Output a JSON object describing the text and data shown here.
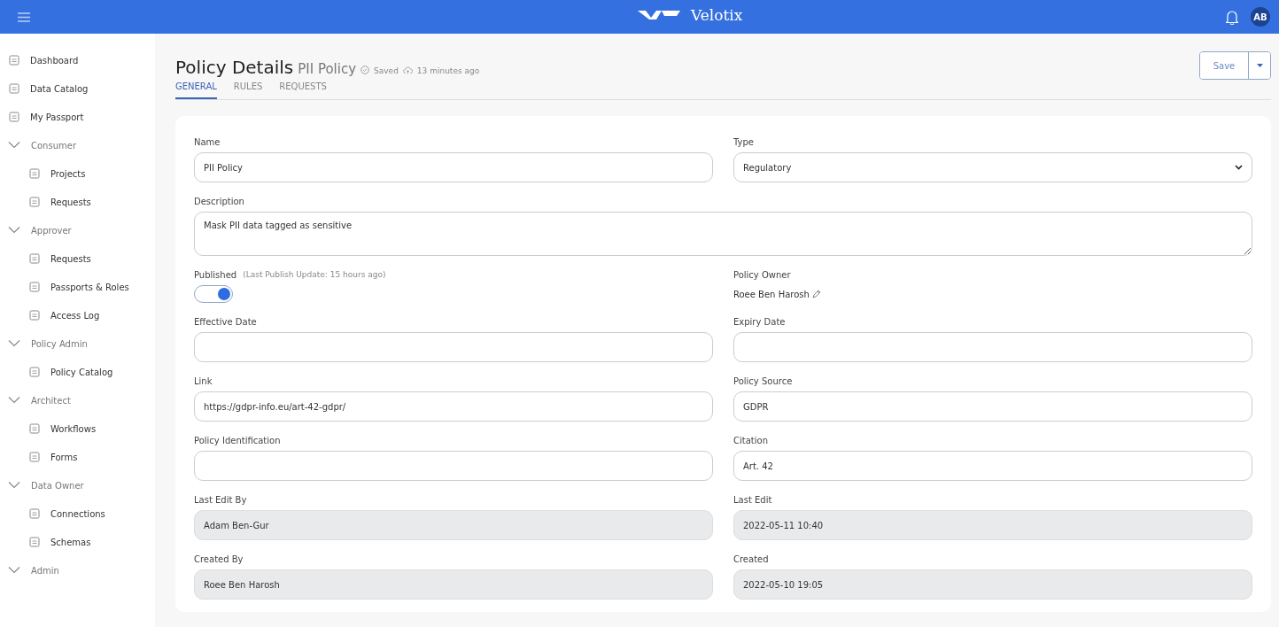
{
  "header": {
    "brand": "Velotix",
    "avatar": "AB"
  },
  "sidebar": {
    "items": [
      {
        "kind": "link",
        "label": "Dashboard"
      },
      {
        "kind": "link",
        "label": "Data Catalog"
      },
      {
        "kind": "link",
        "label": "My Passport"
      },
      {
        "kind": "group",
        "label": "Consumer",
        "expanded": true,
        "children": [
          {
            "label": "Projects"
          },
          {
            "label": "Requests"
          }
        ]
      },
      {
        "kind": "group",
        "label": "Approver",
        "expanded": true,
        "children": [
          {
            "label": "Requests"
          },
          {
            "label": "Passports & Roles"
          },
          {
            "label": "Access Log"
          }
        ]
      },
      {
        "kind": "group",
        "label": "Policy Admin",
        "expanded": true,
        "children": [
          {
            "label": "Policy Catalog"
          }
        ]
      },
      {
        "kind": "group",
        "label": "Architect",
        "expanded": true,
        "children": [
          {
            "label": "Workflows"
          },
          {
            "label": "Forms"
          }
        ]
      },
      {
        "kind": "group",
        "label": "Data Owner",
        "expanded": true,
        "children": [
          {
            "label": "Connections"
          },
          {
            "label": "Schemas"
          }
        ]
      },
      {
        "kind": "group",
        "label": "Admin",
        "expanded": true
      }
    ]
  },
  "page": {
    "title": "Policy Details",
    "subtitle": "PII Policy",
    "saved": "Saved",
    "updated": "13 minutes ago",
    "save_button": "Save"
  },
  "tabs": [
    {
      "label": "GENERAL",
      "selected": true
    },
    {
      "label": "RULES",
      "selected": false
    },
    {
      "label": "REQUESTS",
      "selected": false
    }
  ],
  "fields": [
    {
      "kind": "text",
      "label": "Name",
      "value": "PII Policy",
      "disabled": false
    },
    {
      "kind": "select",
      "label": "Type",
      "value": "Regulatory",
      "disabled": false
    },
    {
      "kind": "textarea",
      "label": "Description",
      "value": "Mask PII data tagged as sensitive",
      "disabled": false
    },
    {
      "kind": "toggle",
      "label": "Published",
      "note": "(Last Publish Update: 15 hours ago)",
      "on": true
    },
    {
      "kind": "person",
      "label": "Policy Owner",
      "value": "Roee Ben Harosh"
    },
    {
      "kind": "text",
      "label": "Effective Date",
      "disabled": false
    },
    {
      "kind": "text",
      "label": "Expiry Date",
      "disabled": false
    },
    {
      "kind": "text",
      "label": "Link",
      "value": "https://gdpr-info.eu/art-42-gdpr/",
      "disabled": false
    },
    {
      "kind": "text",
      "label": "Policy Source",
      "value": "GDPR",
      "disabled": false
    },
    {
      "kind": "text",
      "label": "Policy Identification",
      "disabled": false
    },
    {
      "kind": "text",
      "label": "Citation",
      "value": "Art. 42",
      "disabled": false
    },
    {
      "kind": "text",
      "label": "Last Edit By",
      "value": "Adam Ben-Gur",
      "disabled": true
    },
    {
      "kind": "text",
      "label": "Last Edit",
      "value": "2022-05-11 10:40",
      "disabled": true
    },
    {
      "kind": "text",
      "label": "Created By",
      "value": "Roee Ben Harosh",
      "disabled": true
    },
    {
      "kind": "text",
      "label": "Created",
      "value": "2022-05-10 19:05",
      "disabled": true
    }
  ]
}
